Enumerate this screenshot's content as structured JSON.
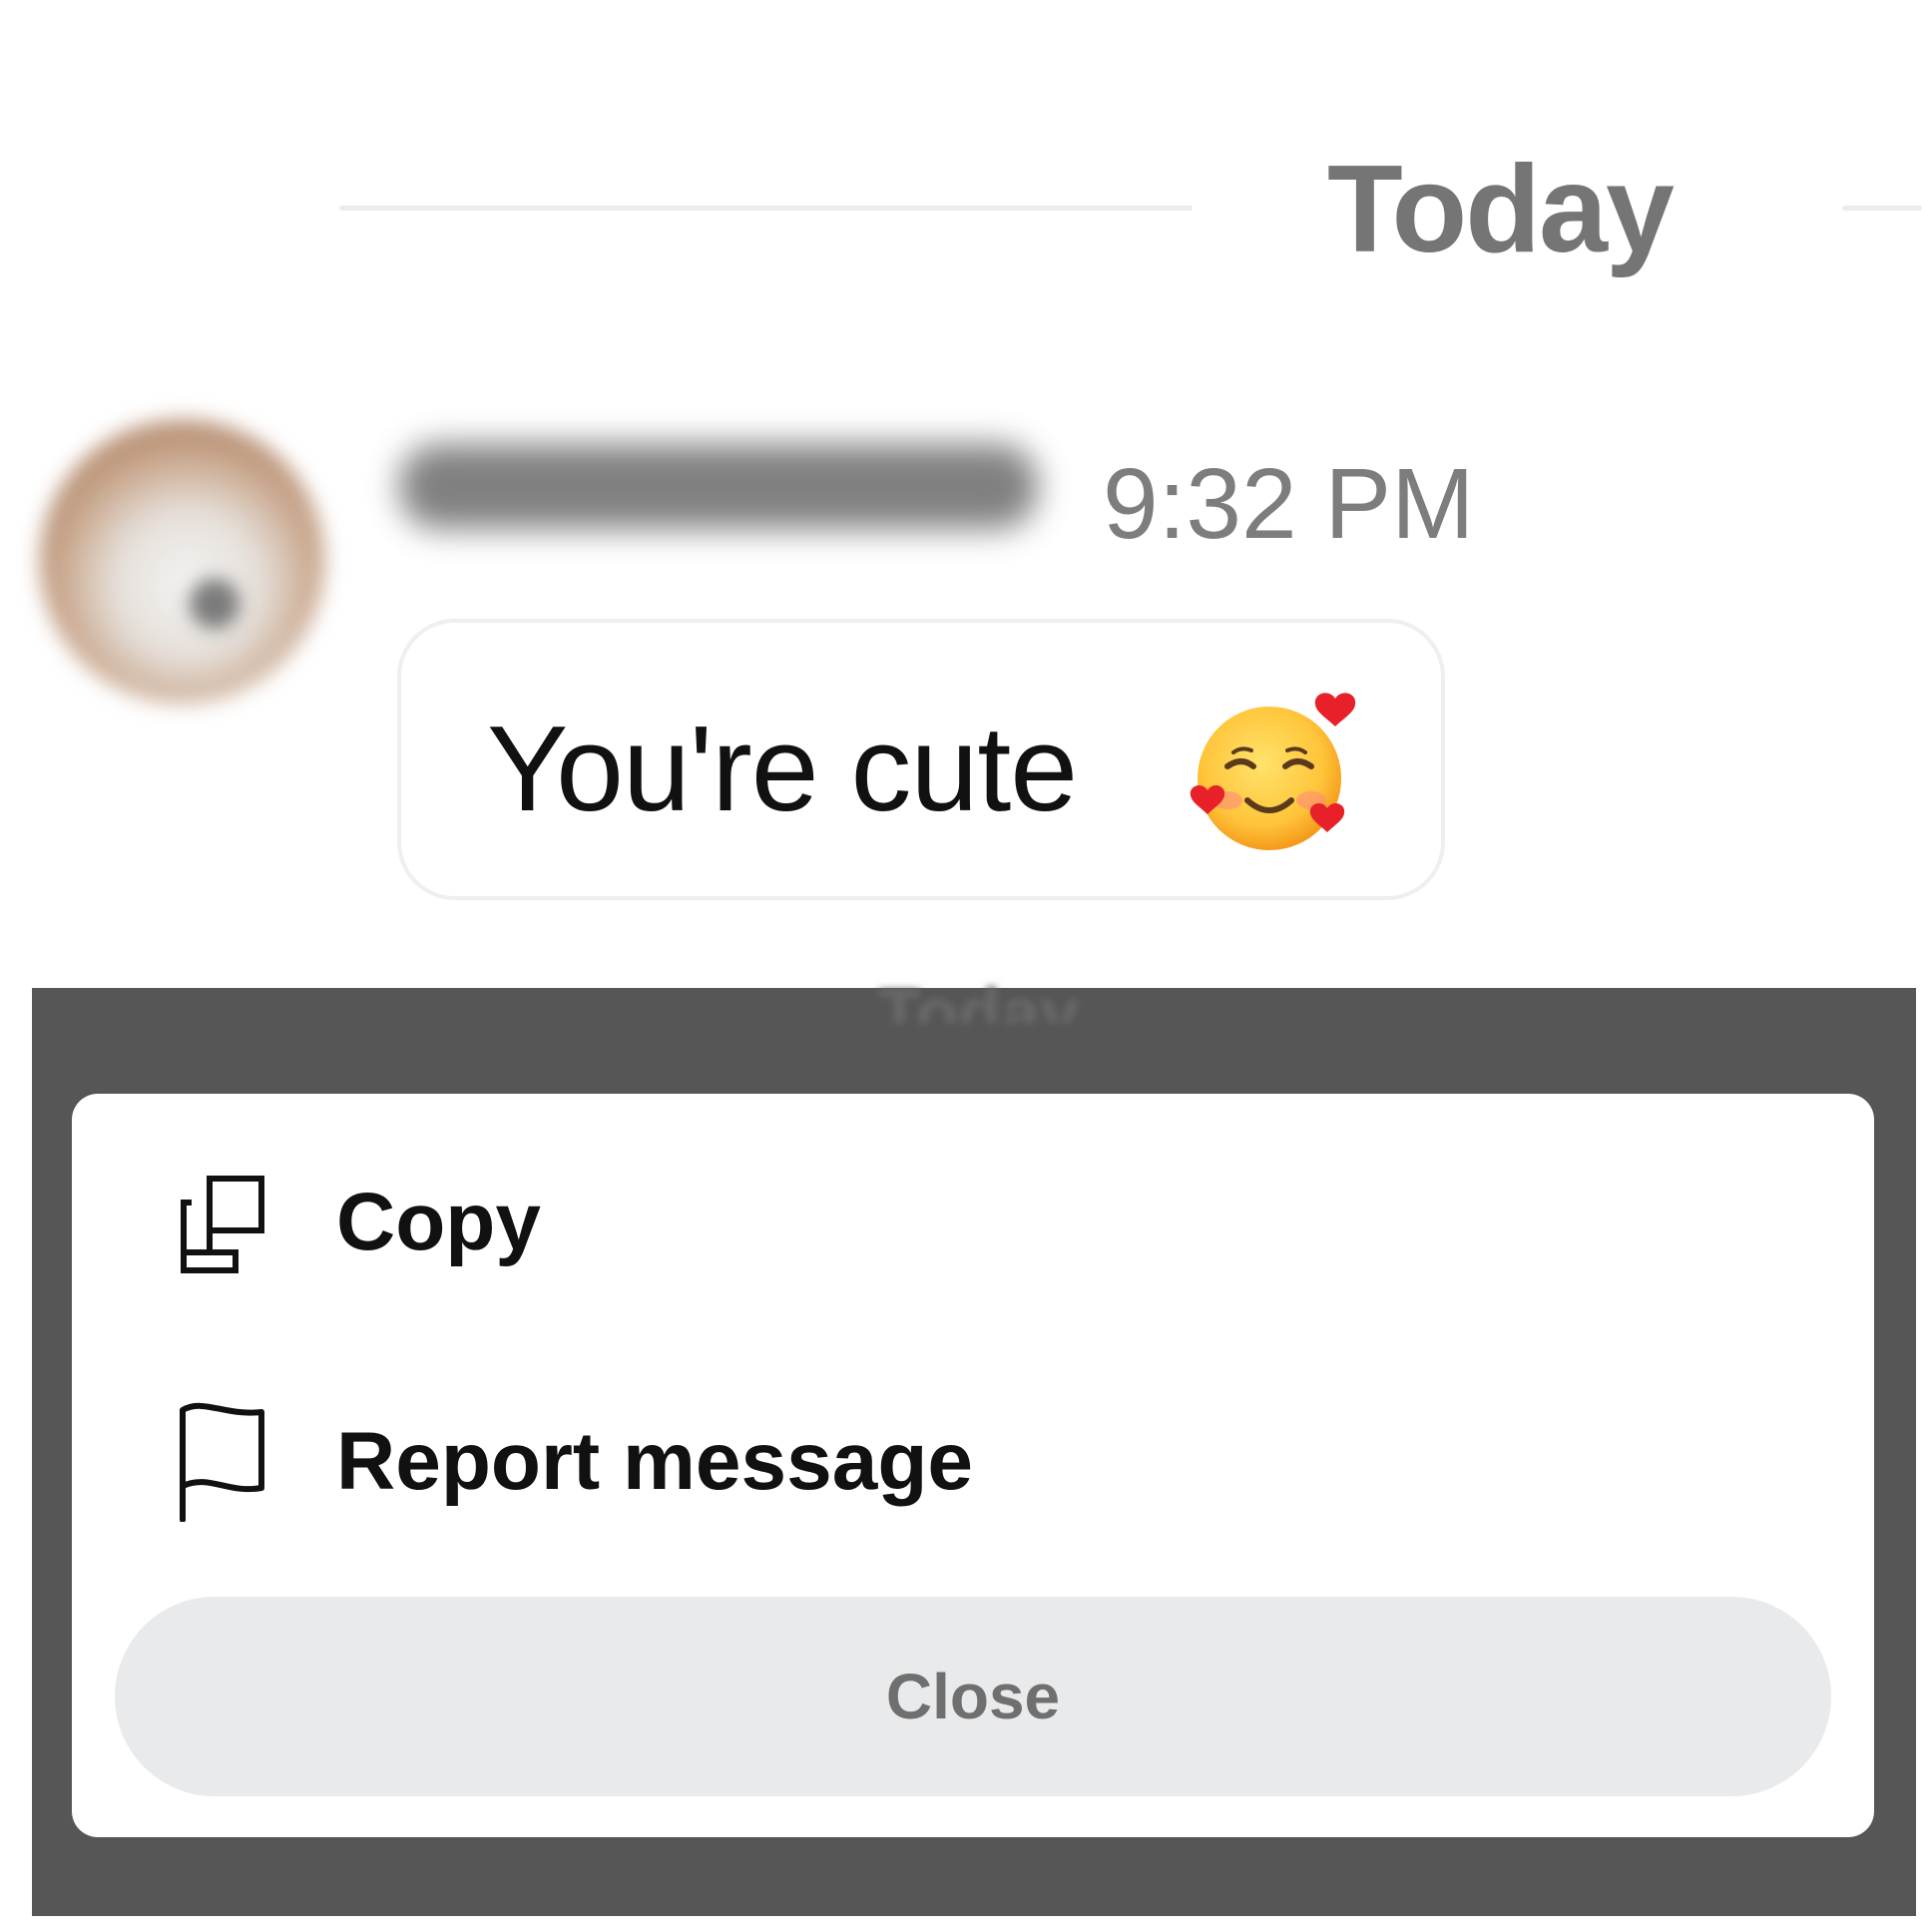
{
  "chat": {
    "date_divider": "Today",
    "message": {
      "timestamp": "9:32 PM",
      "text": "You're cute",
      "emoji_icon": "smiling-face-with-hearts-emoji"
    }
  },
  "action_sheet": {
    "items": [
      {
        "label": "Copy",
        "icon": "copy-icon"
      },
      {
        "label": "Report message",
        "icon": "flag-icon"
      }
    ],
    "close_label": "Close"
  },
  "colors": {
    "overlay": "#565656",
    "close_button_bg": "#e9eaec",
    "close_button_text": "#6f6f6f",
    "date_text": "#757575",
    "timestamp_text": "#7d7d7d"
  }
}
